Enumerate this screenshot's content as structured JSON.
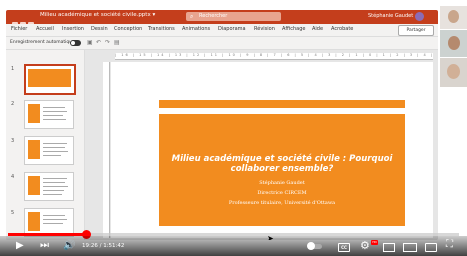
{
  "ppt": {
    "title_bar": {
      "document_name": "Milieu académique et société civile.pptx ▾",
      "search_placeholder": "Rechercher",
      "user_name": "Stéphanie Gaudet"
    },
    "menu": [
      "Fichier",
      "Accueil",
      "Insertion",
      "Dessin",
      "Conception",
      "Transitions",
      "Animations",
      "Diaporama",
      "Révision",
      "Affichage",
      "Aide",
      "Acrobate"
    ],
    "share_label": "Partager",
    "autosave_label": "Enregistrement automatique",
    "slide_numbers": [
      "1",
      "2",
      "3",
      "4",
      "5"
    ],
    "slide": {
      "title": "Milieu académique et société civile : Pourquoi collaborer ensemble?",
      "author": "Stéphanie Gaudet",
      "role": "Directrice CIRCEM",
      "affiliation": "Professeure titulaire, Université d'Ottawa"
    },
    "colors": {
      "accent": "#c43e1c",
      "slide_orange": "#f28c1f",
      "progress": "#ff0000"
    }
  },
  "player": {
    "time": "19:26 / 1:51:42",
    "progress_fraction": 0.174,
    "cc_label": "CC",
    "hd_label": "HD",
    "icons": [
      "play-icon",
      "next-icon",
      "volume-icon",
      "autoplay-toggle",
      "subtitles-icon",
      "settings-icon",
      "miniplayer-icon",
      "theater-icon",
      "cast-icon",
      "fullscreen-icon"
    ]
  }
}
